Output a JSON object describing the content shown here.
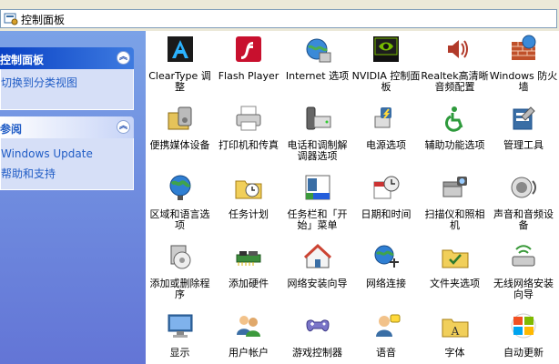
{
  "address": {
    "text": "控制面板"
  },
  "sidebar": {
    "panel1": {
      "title": "控制面板",
      "link": "切换到分类视图"
    },
    "panel2": {
      "title": "参阅",
      "links": [
        "Windows Update",
        "帮助和支持"
      ]
    }
  },
  "items": [
    [
      "ClearType 调整",
      "cleartype-icon"
    ],
    [
      "Flash Player",
      "flash-icon"
    ],
    [
      "Internet 选项",
      "internet-options-icon"
    ],
    [
      "NVIDIA 控制面板",
      "nvidia-icon"
    ],
    [
      "Realtek高清晰音频配置",
      "realtek-icon"
    ],
    [
      "Windows 防火墙",
      "firewall-icon"
    ],
    [
      "便携媒体设备",
      "portable-media-icon"
    ],
    [
      "打印机和传真",
      "printer-icon"
    ],
    [
      "电话和调制解调器选项",
      "phone-modem-icon"
    ],
    [
      "电源选项",
      "power-icon"
    ],
    [
      "辅助功能选项",
      "accessibility-icon"
    ],
    [
      "管理工具",
      "admin-tools-icon"
    ],
    [
      "区域和语言选项",
      "region-globe-icon"
    ],
    [
      "任务计划",
      "scheduled-tasks-icon"
    ],
    [
      "任务栏和「开始」菜单",
      "taskbar-icon"
    ],
    [
      "日期和时间",
      "datetime-icon"
    ],
    [
      "扫描仪和照相机",
      "scanner-icon"
    ],
    [
      "声音和音频设备",
      "sound-icon"
    ],
    [
      "添加或删除程序",
      "add-remove-icon"
    ],
    [
      "添加硬件",
      "add-hardware-icon"
    ],
    [
      "网络安装向导",
      "network-wizard-icon"
    ],
    [
      "网络连接",
      "network-connections-icon"
    ],
    [
      "文件夹选项",
      "folder-options-icon"
    ],
    [
      "无线网络安装向导",
      "wireless-wizard-icon"
    ],
    [
      "显示",
      "display-icon"
    ],
    [
      "用户帐户",
      "user-accounts-icon"
    ],
    [
      "游戏控制器",
      "game-controller-icon"
    ],
    [
      "语音",
      "speech-icon"
    ],
    [
      "字体",
      "fonts-icon"
    ],
    [
      "自动更新",
      "auto-update-icon"
    ]
  ]
}
